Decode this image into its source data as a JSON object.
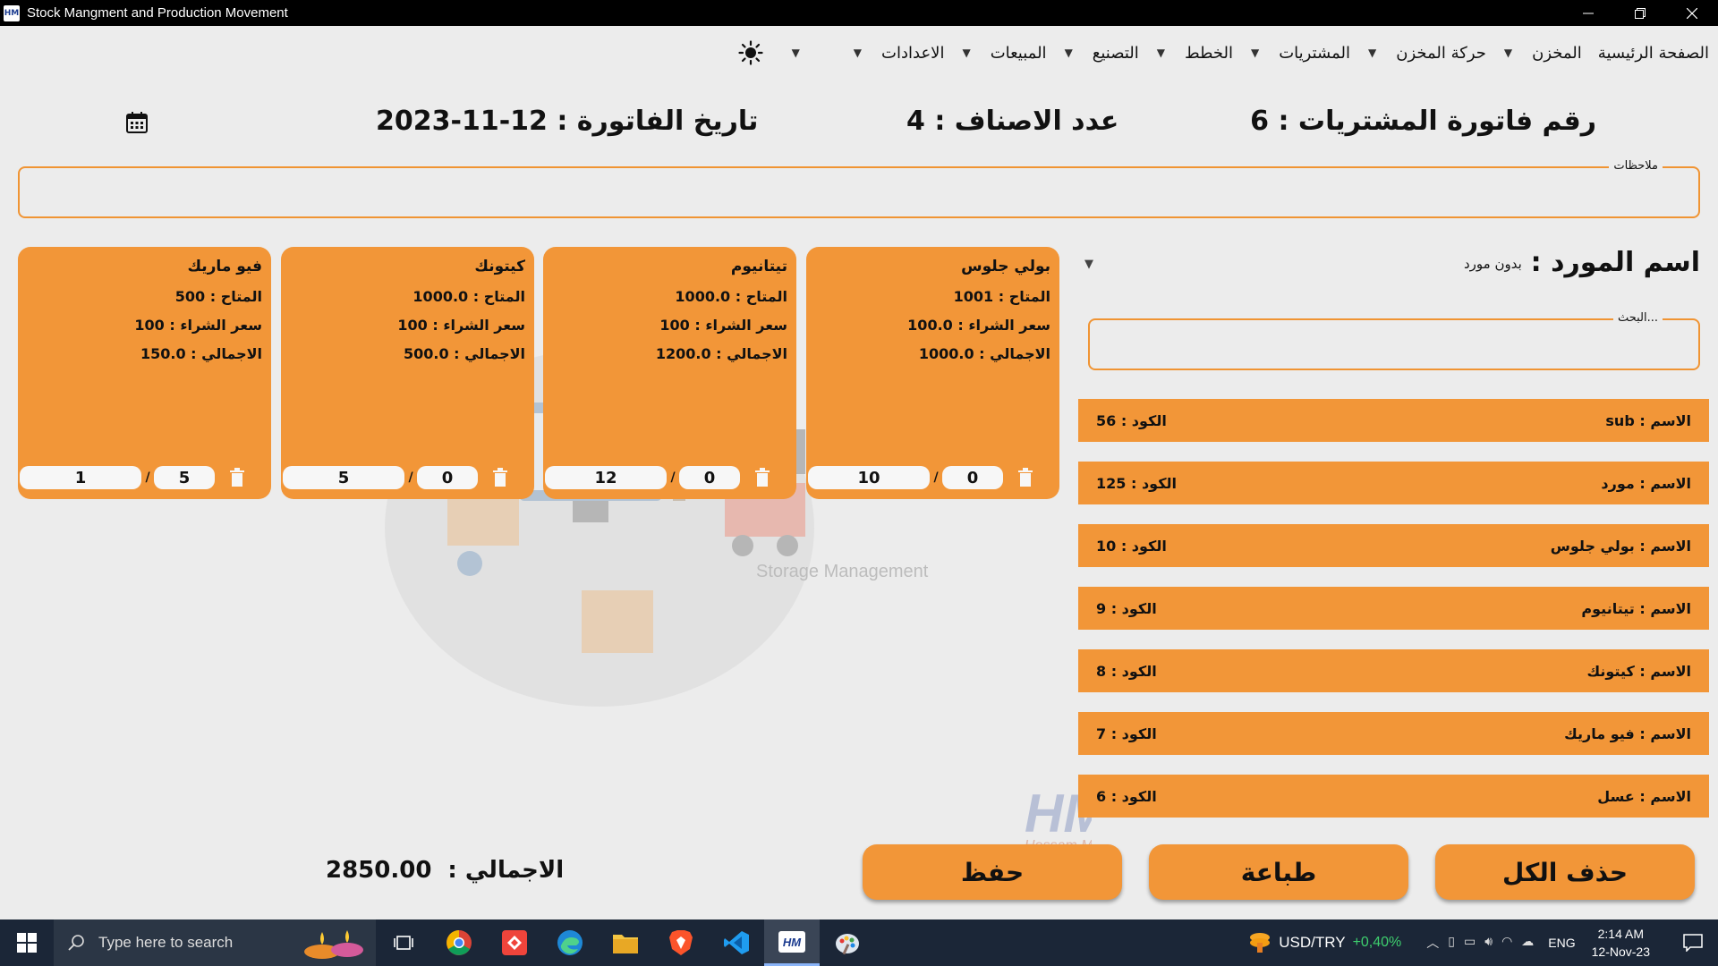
{
  "window": {
    "title": "Stock Mangment and Production Movement",
    "icon_text": "HM"
  },
  "menu": [
    {
      "label": "الصفحة الرئيسية",
      "has_caret": false
    },
    {
      "label": "المخزن",
      "has_caret": true
    },
    {
      "label": "حركة المخزن",
      "has_caret": true
    },
    {
      "label": "المشتريات",
      "has_caret": true
    },
    {
      "label": "الخطط",
      "has_caret": true
    },
    {
      "label": "التصنيع",
      "has_caret": true
    },
    {
      "label": "المبيعات",
      "has_caret": true
    },
    {
      "label": "الاعدادات",
      "has_caret": true
    }
  ],
  "header": {
    "invoice_number": "رقم فاتورة المشتريات : 6",
    "item_count": "عدد الاصناف : 4",
    "invoice_date": "تاريخ الفاتورة : 12-11-2023"
  },
  "notes": {
    "label": "ملاحظات",
    "value": ""
  },
  "supplier": {
    "label": "اسم المورد :",
    "value": "بدون مورد"
  },
  "search": {
    "label": "البحث...",
    "value": ""
  },
  "cards": [
    {
      "name": "بولي جلوس",
      "available": "المتاح : 1001",
      "price": "سعر الشراء : 100.0",
      "total": "الاجمالي : 1000.0",
      "qty": "10",
      "extra": "0"
    },
    {
      "name": "تيتانيوم",
      "available": "المتاح : 1000.0",
      "price": "سعر الشراء : 100",
      "total": "الاجمالي : 1200.0",
      "qty": "12",
      "extra": "0"
    },
    {
      "name": "كيتونك",
      "available": "المتاح : 1000.0",
      "price": "سعر الشراء : 100",
      "total": "الاجمالي : 500.0",
      "qty": "5",
      "extra": "0"
    },
    {
      "name": "فيو ماريك",
      "available": "المتاح : 500",
      "price": "سعر الشراء : 100",
      "total": "الاجمالي : 150.0",
      "qty": "1",
      "extra": "5"
    }
  ],
  "items": [
    {
      "name": "الاسم : sub",
      "code": "الكود : 56"
    },
    {
      "name": "الاسم : مورد",
      "code": "الكود : 125"
    },
    {
      "name": "الاسم : بولي جلوس",
      "code": "الكود : 10"
    },
    {
      "name": "الاسم : تيتانيوم",
      "code": "الكود : 9"
    },
    {
      "name": "الاسم : كيتونك",
      "code": "الكود : 8"
    },
    {
      "name": "الاسم : فيو ماريك",
      "code": "الكود : 7"
    },
    {
      "name": "الاسم : عسل",
      "code": "الكود : 6"
    }
  ],
  "buttons": {
    "delete_all": "حذف الكل",
    "print": "طباعة",
    "save": "حفظ"
  },
  "grand_total": {
    "label": "الاجمالي :",
    "value": "2850.00"
  },
  "watermark": {
    "caption": "Storage Management",
    "author": "Hossam Magdy"
  },
  "taskbar": {
    "search_placeholder": "Type here to search",
    "ticker_symbol": "USD/TRY",
    "ticker_change": "+0,40%",
    "language": "ENG",
    "time": "2:14 AM",
    "date": "12-Nov-23"
  },
  "colors": {
    "accent": "#f29638",
    "border": "#f09433",
    "background": "#ececec",
    "taskbar": "#1b2637"
  }
}
